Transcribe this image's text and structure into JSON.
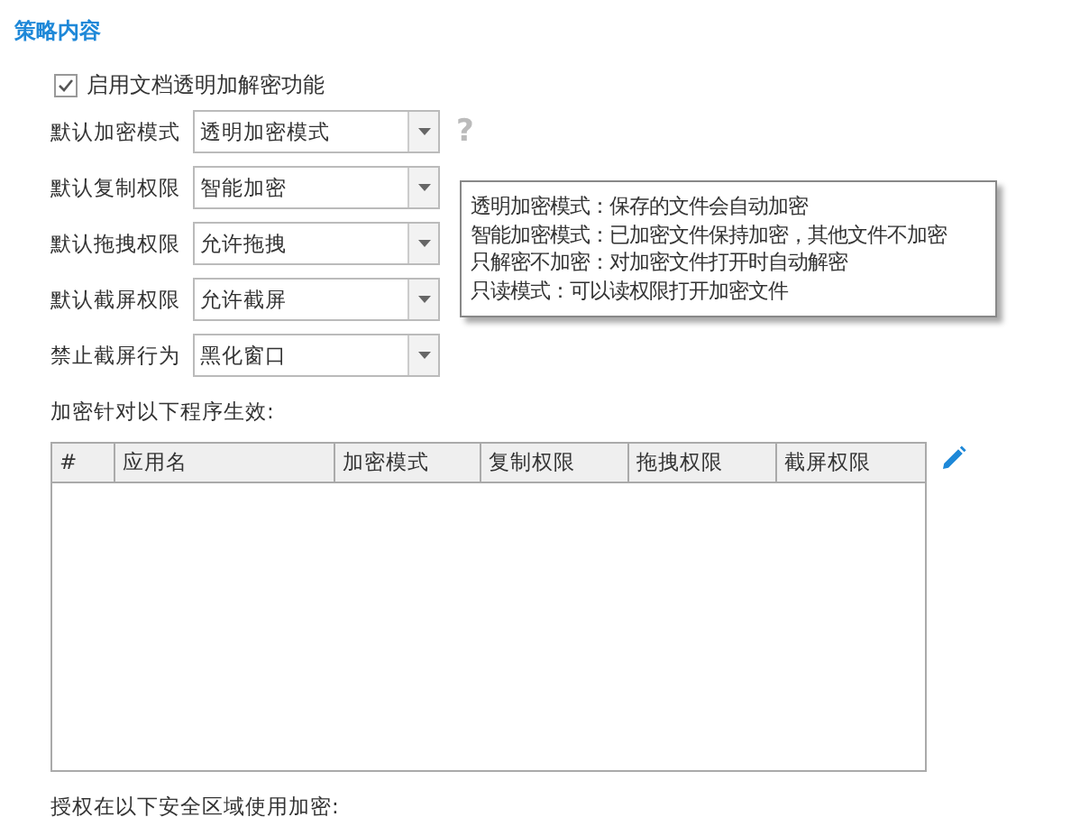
{
  "section_title": "策略内容",
  "enable_option": {
    "label": "启用文档透明加解密功能",
    "checked": true
  },
  "settings": [
    {
      "label": "默认加密模式",
      "value": "透明加密模式",
      "help": "?"
    },
    {
      "label": "默认复制权限",
      "value": "智能加密"
    },
    {
      "label": "默认拖拽权限",
      "value": "允许拖拽"
    },
    {
      "label": "默认截屏权限",
      "value": "允许截屏"
    },
    {
      "label": "禁止截屏行为",
      "value": "黑化窗口"
    }
  ],
  "tooltip": {
    "lines": [
      "透明加密模式：保存的文件会自动加密",
      "智能加密模式：已加密文件保持加密，其他文件不加密",
      "只解密不加密：对加密文件打开时自动解密",
      "只读模式：可以读权限打开加密文件"
    ]
  },
  "programs_label": "加密针对以下程序生效:",
  "table": {
    "columns": [
      "#",
      "应用名",
      "加密模式",
      "复制权限",
      "拖拽权限",
      "截屏权限"
    ]
  },
  "zones_label": "授权在以下安全区域使用加密:"
}
